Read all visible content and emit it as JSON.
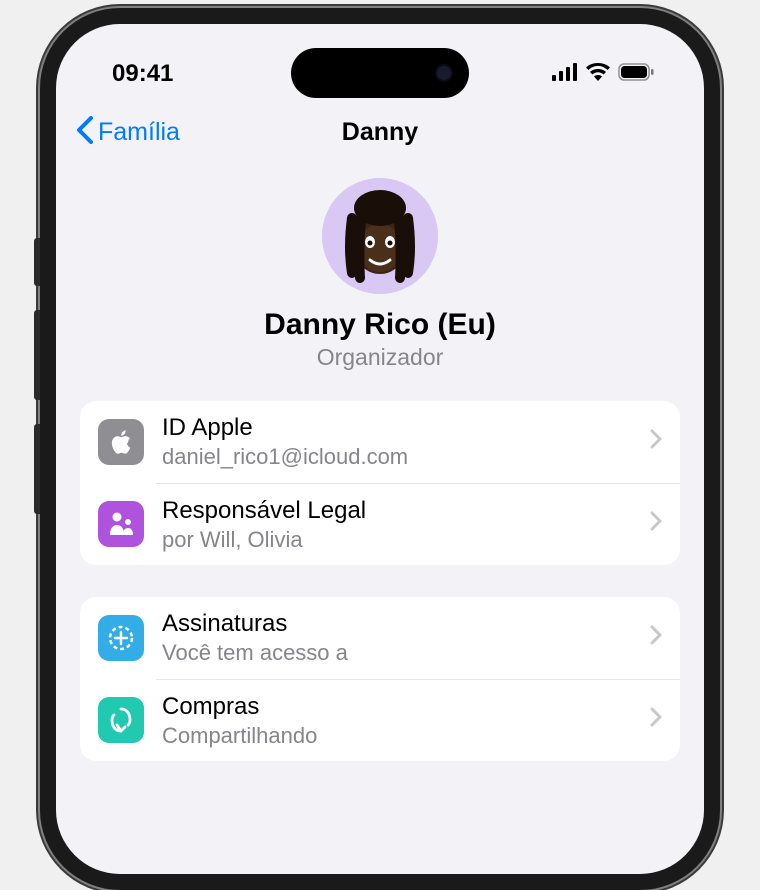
{
  "status": {
    "time": "09:41"
  },
  "nav": {
    "back_label": "Família",
    "title": "Danny"
  },
  "profile": {
    "name": "Danny Rico (Eu)",
    "role": "Organizador"
  },
  "group1": {
    "items": [
      {
        "icon": "apple-logo-icon",
        "icon_color": "#8e8e93",
        "title": "ID Apple",
        "subtitle": "daniel_rico1@icloud.com"
      },
      {
        "icon": "guardian-icon",
        "icon_color": "#af52de",
        "title": "Responsável Legal",
        "subtitle": "por Will, Olivia"
      }
    ]
  },
  "group2": {
    "items": [
      {
        "icon": "subscriptions-icon",
        "icon_color": "#32ade6",
        "title": "Assinaturas",
        "subtitle": "Você tem acesso a"
      },
      {
        "icon": "purchases-icon",
        "icon_color": "#20c9b0",
        "title": "Compras",
        "subtitle": "Compartilhando"
      }
    ]
  }
}
